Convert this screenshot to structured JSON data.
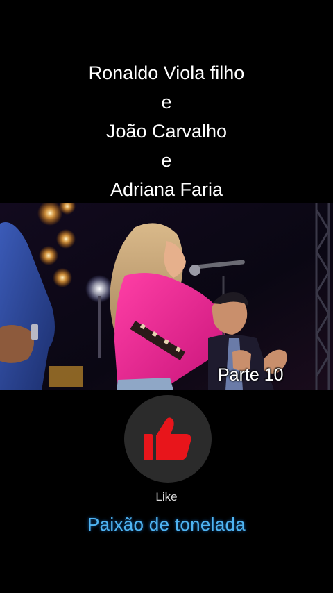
{
  "title": {
    "lines": [
      "Ronaldo Viola filho",
      "e",
      "João Carvalho",
      "e",
      "Adriana Faria"
    ]
  },
  "video": {
    "part_label": "Parte 10"
  },
  "like": {
    "icon": "thumbs-up-icon",
    "label": "Like",
    "icon_color": "#e8151b",
    "button_color": "#2b2b2b"
  },
  "channel": {
    "name": "Paixão de tonelada",
    "color": "#4fb4f2"
  }
}
